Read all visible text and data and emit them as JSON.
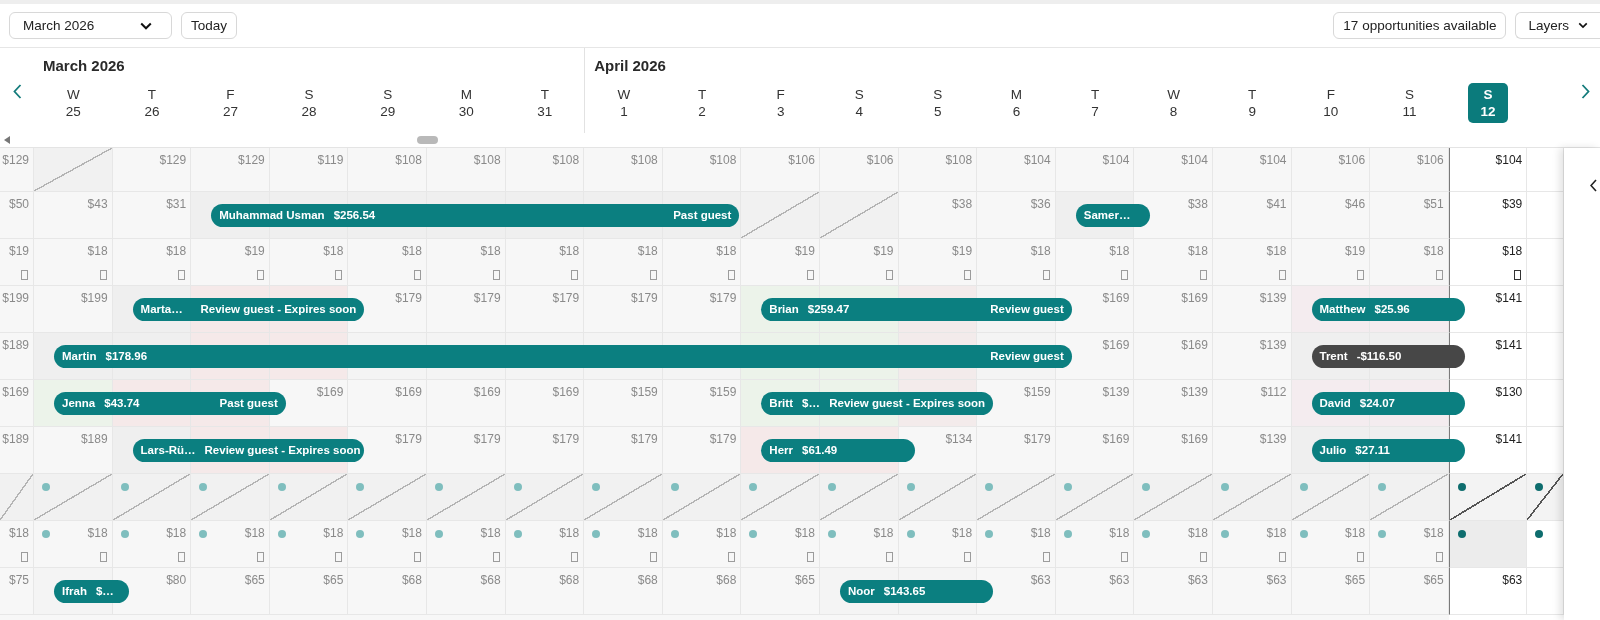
{
  "toolbar": {
    "month_picker": "March 2026",
    "today_button": "Today",
    "opportunities_button": "17 opportunities available",
    "layers_button": "Layers"
  },
  "header": {
    "months": [
      {
        "label": "March 2026",
        "days": [
          {
            "weekday": "W",
            "date": "25",
            "selected": false
          },
          {
            "weekday": "T",
            "date": "26",
            "selected": false
          },
          {
            "weekday": "F",
            "date": "27",
            "selected": false
          },
          {
            "weekday": "S",
            "date": "28",
            "selected": false
          },
          {
            "weekday": "S",
            "date": "29",
            "selected": false
          },
          {
            "weekday": "M",
            "date": "30",
            "selected": false
          },
          {
            "weekday": "T",
            "date": "31",
            "selected": false
          }
        ]
      },
      {
        "label": "April 2026",
        "days": [
          {
            "weekday": "W",
            "date": "1",
            "selected": false
          },
          {
            "weekday": "T",
            "date": "2",
            "selected": false
          },
          {
            "weekday": "F",
            "date": "3",
            "selected": false
          },
          {
            "weekday": "S",
            "date": "4",
            "selected": false
          },
          {
            "weekday": "S",
            "date": "5",
            "selected": false
          },
          {
            "weekday": "M",
            "date": "6",
            "selected": false
          },
          {
            "weekday": "T",
            "date": "7",
            "selected": false
          },
          {
            "weekday": "W",
            "date": "8",
            "selected": false
          },
          {
            "weekday": "T",
            "date": "9",
            "selected": false
          },
          {
            "weekday": "F",
            "date": "10",
            "selected": false
          },
          {
            "weekday": "S",
            "date": "11",
            "selected": false
          },
          {
            "weekday": "S",
            "date": "12",
            "selected": true
          }
        ]
      }
    ]
  },
  "rows": [
    {
      "dots": false,
      "glyphs": false,
      "cells": [
        {
          "kind": "price",
          "price": "$129"
        },
        {
          "kind": "blocked"
        },
        {
          "kind": "price",
          "price": "$129"
        },
        {
          "kind": "price",
          "price": "$129"
        },
        {
          "kind": "price",
          "price": "$119"
        },
        {
          "kind": "price",
          "price": "$108"
        },
        {
          "kind": "price",
          "price": "$108"
        },
        {
          "kind": "price",
          "price": "$108"
        },
        {
          "kind": "price",
          "price": "$108"
        },
        {
          "kind": "price",
          "price": "$108"
        },
        {
          "kind": "price",
          "price": "$106"
        },
        {
          "kind": "price",
          "price": "$106"
        },
        {
          "kind": "price",
          "price": "$108"
        },
        {
          "kind": "price",
          "price": "$104"
        },
        {
          "kind": "price",
          "price": "$104"
        },
        {
          "kind": "price",
          "price": "$104"
        },
        {
          "kind": "price",
          "price": "$104"
        },
        {
          "kind": "price",
          "price": "$106"
        },
        {
          "kind": "price",
          "price": "$106"
        },
        {
          "kind": "price",
          "price": "$104"
        },
        {
          "kind": "price"
        }
      ]
    },
    {
      "dots": false,
      "glyphs": false,
      "cells": [
        {
          "kind": "price",
          "price": "$50"
        },
        {
          "kind": "price",
          "price": "$43"
        },
        {
          "kind": "price",
          "price": "$31"
        },
        {
          "kind": "stay",
          "color": "#efefef",
          "booking": {
            "kind": "reservation",
            "guest": "Muhammad Usman",
            "amount": "$256.54",
            "note": "Past guest"
          }
        },
        {
          "kind": "stay",
          "color": "#efefef"
        },
        {
          "kind": "stay",
          "color": "#efefef"
        },
        {
          "kind": "stay",
          "color": "#efefef"
        },
        {
          "kind": "stay",
          "color": "#efefef"
        },
        {
          "kind": "stay",
          "color": "#efefef"
        },
        {
          "kind": "stay",
          "color": "#efefef"
        },
        {
          "kind": "blocked"
        },
        {
          "kind": "blocked"
        },
        {
          "kind": "price",
          "price": "$38"
        },
        {
          "kind": "price",
          "price": "$36"
        },
        {
          "kind": "stay",
          "color": "#efefef",
          "booking": {
            "kind": "reservation",
            "guest": "Samer…"
          }
        },
        {
          "kind": "price",
          "price": "$38"
        },
        {
          "kind": "price",
          "price": "$41"
        },
        {
          "kind": "price",
          "price": "$46"
        },
        {
          "kind": "price",
          "price": "$51"
        },
        {
          "kind": "price",
          "price": "$39"
        },
        {
          "kind": "price"
        }
      ]
    },
    {
      "dots": false,
      "glyphs": true,
      "cells": [
        {
          "kind": "price",
          "price": "$19"
        },
        {
          "kind": "price",
          "price": "$18"
        },
        {
          "kind": "price",
          "price": "$18"
        },
        {
          "kind": "price",
          "price": "$19"
        },
        {
          "kind": "price",
          "price": "$18"
        },
        {
          "kind": "price",
          "price": "$18"
        },
        {
          "kind": "price",
          "price": "$18"
        },
        {
          "kind": "price",
          "price": "$18"
        },
        {
          "kind": "price",
          "price": "$18"
        },
        {
          "kind": "price",
          "price": "$18"
        },
        {
          "kind": "price",
          "price": "$19"
        },
        {
          "kind": "price",
          "price": "$19"
        },
        {
          "kind": "price",
          "price": "$19"
        },
        {
          "kind": "price",
          "price": "$18"
        },
        {
          "kind": "price",
          "price": "$18"
        },
        {
          "kind": "price",
          "price": "$18"
        },
        {
          "kind": "price",
          "price": "$18"
        },
        {
          "kind": "price",
          "price": "$19"
        },
        {
          "kind": "price",
          "price": "$18"
        },
        {
          "kind": "price",
          "price": "$18"
        },
        {
          "kind": "price"
        }
      ]
    },
    {
      "dots": false,
      "glyphs": false,
      "cells": [
        {
          "kind": "price",
          "price": "$199"
        },
        {
          "kind": "price",
          "price": "$199"
        },
        {
          "kind": "stay",
          "color": "#efefef",
          "booking": {
            "kind": "reservation",
            "guest": "Marta…",
            "note": "Review guest - Expires soon"
          }
        },
        {
          "kind": "stay",
          "color": "#f5e9e9"
        },
        {
          "kind": "stay",
          "color": "#f5e9e9"
        },
        {
          "kind": "price",
          "price": "$179"
        },
        {
          "kind": "price",
          "price": "$179"
        },
        {
          "kind": "price",
          "price": "$179"
        },
        {
          "kind": "price",
          "price": "$179"
        },
        {
          "kind": "price",
          "price": "$179"
        },
        {
          "kind": "stay",
          "color": "#ecf3ea",
          "booking": {
            "kind": "reservation",
            "guest": "Brian",
            "amount": "$259.47",
            "note": "Review guest"
          }
        },
        {
          "kind": "stay",
          "color": "#ecf3ea"
        },
        {
          "kind": "stay",
          "color": "#f3ebeb"
        },
        {
          "kind": "stay",
          "color": "#f4f4f4"
        },
        {
          "kind": "price",
          "price": "$169"
        },
        {
          "kind": "price",
          "price": "$169"
        },
        {
          "kind": "price",
          "price": "$139"
        },
        {
          "kind": "stay",
          "color": "#f4ecef",
          "booking": {
            "kind": "reservation",
            "guest": "Matthew",
            "amount": "$25.96"
          }
        },
        {
          "kind": "stay",
          "color": "#f4ecef"
        },
        {
          "kind": "price",
          "price": "$141"
        },
        {
          "kind": "price"
        }
      ]
    },
    {
      "dots": false,
      "glyphs": false,
      "cells": [
        {
          "kind": "price",
          "price": "$189"
        },
        {
          "kind": "stay",
          "color": "#efefef",
          "booking": {
            "kind": "reservation",
            "guest": "Martin",
            "amount": "$178.96",
            "note": "Review guest"
          }
        },
        {
          "kind": "stay",
          "color": "#efefef"
        },
        {
          "kind": "stay",
          "color": "#f5e9e9"
        },
        {
          "kind": "stay",
          "color": "#f5e9e9"
        },
        {
          "kind": "stay",
          "color": "#f4f4f4"
        },
        {
          "kind": "stay",
          "color": "#f4f4f4"
        },
        {
          "kind": "stay",
          "color": "#f4f4f4"
        },
        {
          "kind": "stay",
          "color": "#f4f4f4"
        },
        {
          "kind": "stay",
          "color": "#f4f4f4"
        },
        {
          "kind": "stay",
          "color": "#ecf3ea"
        },
        {
          "kind": "stay",
          "color": "#ecf3ea"
        },
        {
          "kind": "stay",
          "color": "#f3ebeb"
        },
        {
          "kind": "stay",
          "color": "#f4f4f4"
        },
        {
          "kind": "price",
          "price": "$169"
        },
        {
          "kind": "price",
          "price": "$169"
        },
        {
          "kind": "price",
          "price": "$139"
        },
        {
          "kind": "stay",
          "color": "#efefef",
          "booking": {
            "kind": "adjustment",
            "guest": "Trent",
            "amount": "-$116.50"
          }
        },
        {
          "kind": "stay",
          "color": "#efefef"
        },
        {
          "kind": "price",
          "price": "$141"
        },
        {
          "kind": "price"
        }
      ]
    },
    {
      "dots": false,
      "glyphs": false,
      "cells": [
        {
          "kind": "price",
          "price": "$169"
        },
        {
          "kind": "stay",
          "color": "#ecf3ea",
          "booking": {
            "kind": "reservation",
            "guest": "Jenna",
            "amount": "$43.74",
            "note": "Past guest"
          }
        },
        {
          "kind": "stay",
          "color": "#f5e9e9"
        },
        {
          "kind": "stay",
          "color": "#f5e9e9"
        },
        {
          "kind": "price",
          "price": "$169"
        },
        {
          "kind": "price",
          "price": "$169"
        },
        {
          "kind": "price",
          "price": "$169"
        },
        {
          "kind": "price",
          "price": "$169"
        },
        {
          "kind": "price",
          "price": "$159"
        },
        {
          "kind": "price",
          "price": "$159"
        },
        {
          "kind": "stay",
          "color": "#ecf3ea",
          "booking": {
            "kind": "reservation",
            "guest": "Britt",
            "amount": "$…",
            "note": "Review guest - Expires soon"
          }
        },
        {
          "kind": "stay",
          "color": "#ecf3ea"
        },
        {
          "kind": "stay",
          "color": "#f3ebeb"
        },
        {
          "kind": "price",
          "price": "$159"
        },
        {
          "kind": "price",
          "price": "$139"
        },
        {
          "kind": "price",
          "price": "$139"
        },
        {
          "kind": "price",
          "price": "$112"
        },
        {
          "kind": "stay",
          "color": "#f4ecef",
          "booking": {
            "kind": "reservation",
            "guest": "David",
            "amount": "$24.07"
          }
        },
        {
          "kind": "stay",
          "color": "#f4ecef"
        },
        {
          "kind": "price",
          "price": "$130"
        },
        {
          "kind": "price"
        }
      ]
    },
    {
      "dots": false,
      "glyphs": false,
      "cells": [
        {
          "kind": "price",
          "price": "$189"
        },
        {
          "kind": "price",
          "price": "$189"
        },
        {
          "kind": "stay",
          "color": "#efefef",
          "booking": {
            "kind": "reservation",
            "guest": "Lars-Rü…",
            "note": "Review guest - Expires soon"
          }
        },
        {
          "kind": "stay",
          "color": "#f5e9e9"
        },
        {
          "kind": "stay",
          "color": "#f5e9e9"
        },
        {
          "kind": "price",
          "price": "$179"
        },
        {
          "kind": "price",
          "price": "$179"
        },
        {
          "kind": "price",
          "price": "$179"
        },
        {
          "kind": "price",
          "price": "$179"
        },
        {
          "kind": "price",
          "price": "$179"
        },
        {
          "kind": "stay",
          "color": "#f5e9e9",
          "booking": {
            "kind": "reservation",
            "guest": "Herr",
            "amount": "$61.49"
          }
        },
        {
          "kind": "stay",
          "color": "#f5e9e9"
        },
        {
          "kind": "price",
          "price": "$134"
        },
        {
          "kind": "price",
          "price": "$179"
        },
        {
          "kind": "price",
          "price": "$169"
        },
        {
          "kind": "price",
          "price": "$169"
        },
        {
          "kind": "price",
          "price": "$139"
        },
        {
          "kind": "stay",
          "color": "#efefef",
          "booking": {
            "kind": "reservation",
            "guest": "Julio",
            "amount": "$27.11"
          }
        },
        {
          "kind": "stay",
          "color": "#efefef"
        },
        {
          "kind": "price",
          "price": "$141"
        },
        {
          "kind": "price"
        }
      ]
    },
    {
      "dots": true,
      "glyphs": false,
      "cells": [
        {
          "kind": "blocked"
        },
        {
          "kind": "blocked"
        },
        {
          "kind": "blocked"
        },
        {
          "kind": "blocked"
        },
        {
          "kind": "blocked"
        },
        {
          "kind": "blocked"
        },
        {
          "kind": "blocked"
        },
        {
          "kind": "blocked"
        },
        {
          "kind": "blocked"
        },
        {
          "kind": "blocked"
        },
        {
          "kind": "blocked"
        },
        {
          "kind": "blocked"
        },
        {
          "kind": "blocked"
        },
        {
          "kind": "blocked"
        },
        {
          "kind": "blocked"
        },
        {
          "kind": "blocked"
        },
        {
          "kind": "blocked"
        },
        {
          "kind": "blocked"
        },
        {
          "kind": "blocked"
        },
        {
          "kind": "blocked"
        },
        {
          "kind": "blocked"
        }
      ]
    },
    {
      "dots": true,
      "glyphs": true,
      "cells": [
        {
          "kind": "price",
          "price": "$18"
        },
        {
          "kind": "price",
          "price": "$18"
        },
        {
          "kind": "price",
          "price": "$18"
        },
        {
          "kind": "price",
          "price": "$18"
        },
        {
          "kind": "price",
          "price": "$18"
        },
        {
          "kind": "price",
          "price": "$18"
        },
        {
          "kind": "price",
          "price": "$18"
        },
        {
          "kind": "price",
          "price": "$18"
        },
        {
          "kind": "price",
          "price": "$18"
        },
        {
          "kind": "price",
          "price": "$18"
        },
        {
          "kind": "price",
          "price": "$18"
        },
        {
          "kind": "price",
          "price": "$18"
        },
        {
          "kind": "price",
          "price": "$18"
        },
        {
          "kind": "price",
          "price": "$18"
        },
        {
          "kind": "price",
          "price": "$18"
        },
        {
          "kind": "price",
          "price": "$18"
        },
        {
          "kind": "price",
          "price": "$18"
        },
        {
          "kind": "price",
          "price": "$18"
        },
        {
          "kind": "price",
          "price": "$18"
        },
        {
          "kind": "stay",
          "color": "#ececec"
        },
        {
          "kind": "price"
        }
      ]
    },
    {
      "dots": false,
      "glyphs": false,
      "cells": [
        {
          "kind": "price",
          "price": "$75"
        },
        {
          "kind": "stay",
          "color": "#f4f4f4",
          "booking": {
            "kind": "reservation",
            "guest": "Ifrah",
            "amount": "$…"
          }
        },
        {
          "kind": "price",
          "price": "$80"
        },
        {
          "kind": "price",
          "price": "$65"
        },
        {
          "kind": "price",
          "price": "$65"
        },
        {
          "kind": "price",
          "price": "$68"
        },
        {
          "kind": "price",
          "price": "$68"
        },
        {
          "kind": "price",
          "price": "$68"
        },
        {
          "kind": "price",
          "price": "$68"
        },
        {
          "kind": "price",
          "price": "$68"
        },
        {
          "kind": "price",
          "price": "$65"
        },
        {
          "kind": "stay",
          "color": "#f4f4f4",
          "booking": {
            "kind": "reservation",
            "guest": "Noor",
            "amount": "$143.65"
          }
        },
        {
          "kind": "stay",
          "color": "#f4f4f4"
        },
        {
          "kind": "price",
          "price": "$63"
        },
        {
          "kind": "price",
          "price": "$63"
        },
        {
          "kind": "price",
          "price": "$63"
        },
        {
          "kind": "price",
          "price": "$63"
        },
        {
          "kind": "price",
          "price": "$65"
        },
        {
          "kind": "price",
          "price": "$65"
        },
        {
          "kind": "price",
          "price": "$63"
        },
        {
          "kind": "price"
        }
      ]
    }
  ]
}
